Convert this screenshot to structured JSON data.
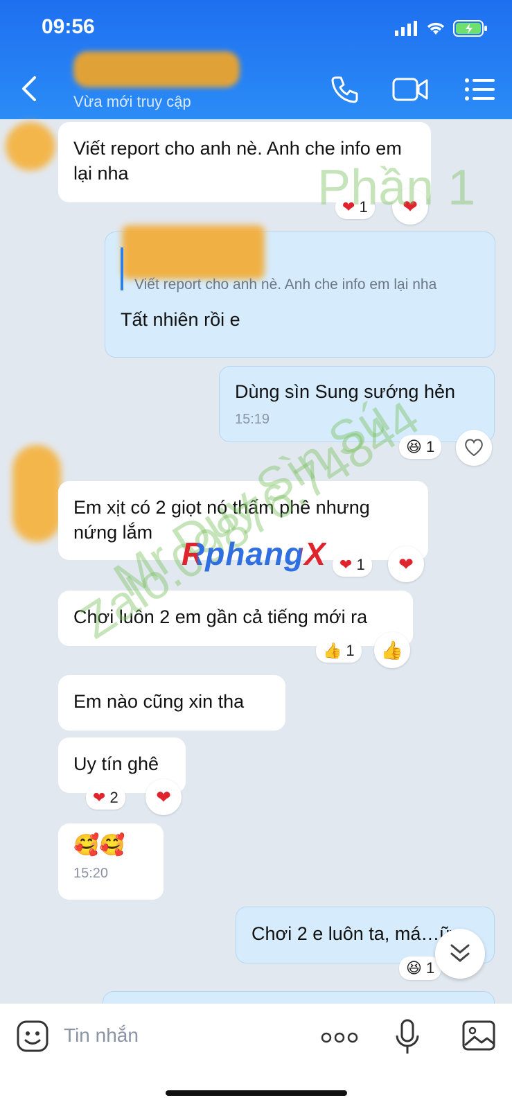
{
  "status_bar": {
    "time": "09:56"
  },
  "header": {
    "contact_status": "Vừa mới truy cập"
  },
  "messages": [
    {
      "text": "Viết report cho anh nè. Anh che info em lại nha",
      "reaction_count": "1"
    },
    {
      "quote_text": "Viết report cho anh nè. Anh che info em lại nha",
      "text": "Tất nhiên rồi e"
    },
    {
      "text": "Dùng sìn Sung sướng hẻn",
      "time": "15:19",
      "reaction_count": "1"
    },
    {
      "text": "Em xịt có 2 giọt nó thấm phê nhưng nứng lắm",
      "reaction_count": "1"
    },
    {
      "text": "Chơi luôn 2 em gần cả tiếng mới ra",
      "reaction_count": "1"
    },
    {
      "text": "Em nào cũng xin tha"
    },
    {
      "text": "Uy tín ghê",
      "reaction_count": "2"
    },
    {
      "text": "🥰🥰",
      "time": "15:20"
    },
    {
      "text": "Chơi 2 e luôn ta, má…ữ",
      "reaction_count": "1"
    }
  ],
  "watermarks": {
    "part": "Phần 1",
    "seller": "Mr Duy Sìn Sú",
    "zalo": "Zalo.09876.74844",
    "logo": "RphangX"
  },
  "input": {
    "placeholder": "Tin nhắn"
  },
  "icons": [
    "back-icon",
    "phone-icon",
    "video-icon",
    "menu-icon",
    "sticker-icon",
    "more-icon",
    "mic-icon",
    "image-icon",
    "heart-icon",
    "laugh-icon",
    "thumbs-up-icon",
    "chevrons-down-icon"
  ],
  "colors": {
    "header": "#2b8cf6",
    "outgoing_bubble": "#d6ecfd",
    "background": "#e2e8f0"
  }
}
